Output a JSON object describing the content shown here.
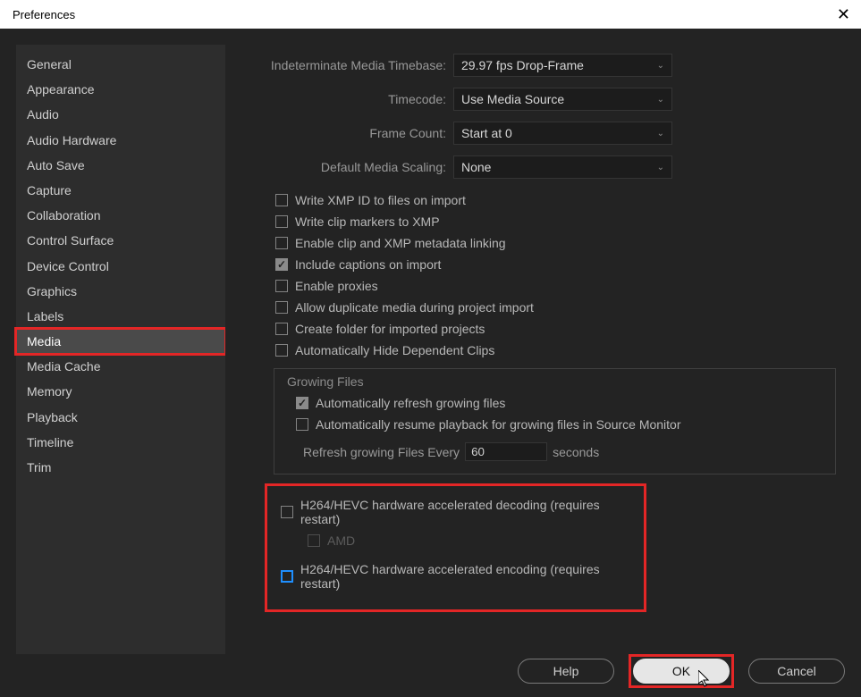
{
  "title": "Preferences",
  "sidebar": {
    "items": [
      "General",
      "Appearance",
      "Audio",
      "Audio Hardware",
      "Auto Save",
      "Capture",
      "Collaboration",
      "Control Surface",
      "Device Control",
      "Graphics",
      "Labels",
      "Media",
      "Media Cache",
      "Memory",
      "Playback",
      "Timeline",
      "Trim"
    ],
    "selected_index": 11
  },
  "dropdowns": {
    "timebase": {
      "label": "Indeterminate Media Timebase:",
      "value": "29.97 fps Drop-Frame"
    },
    "timecode": {
      "label": "Timecode:",
      "value": "Use Media Source"
    },
    "framecount": {
      "label": "Frame Count:",
      "value": "Start at 0"
    },
    "scaling": {
      "label": "Default Media Scaling:",
      "value": "None"
    }
  },
  "checks": {
    "xmp_id": {
      "label": "Write XMP ID to files on import",
      "checked": false
    },
    "clip_markers": {
      "label": "Write clip markers to XMP",
      "checked": false
    },
    "enable_link": {
      "label": "Enable clip and XMP metadata linking",
      "checked": false
    },
    "captions": {
      "label": "Include captions on import",
      "checked": true
    },
    "proxies": {
      "label": "Enable proxies",
      "checked": false
    },
    "dup_media": {
      "label": "Allow duplicate media during project import",
      "checked": false
    },
    "create_folder": {
      "label": "Create folder for imported projects",
      "checked": false
    },
    "hide_deps": {
      "label": "Automatically Hide Dependent Clips",
      "checked": false
    }
  },
  "growing": {
    "title": "Growing Files",
    "auto_refresh": {
      "label": "Automatically refresh growing files",
      "checked": true
    },
    "auto_resume": {
      "label": "Automatically resume playback for growing files in Source Monitor",
      "checked": false
    },
    "refresh_label_pre": "Refresh growing Files Every",
    "refresh_value": "60",
    "refresh_label_post": "seconds"
  },
  "hw": {
    "decode": {
      "label": "H264/HEVC hardware accelerated decoding (requires restart)",
      "checked": false
    },
    "amd": {
      "label": "AMD",
      "checked": false
    },
    "encode": {
      "label": "H264/HEVC hardware accelerated encoding (requires restart)",
      "checked": false
    }
  },
  "buttons": {
    "help": "Help",
    "ok": "OK",
    "cancel": "Cancel"
  }
}
